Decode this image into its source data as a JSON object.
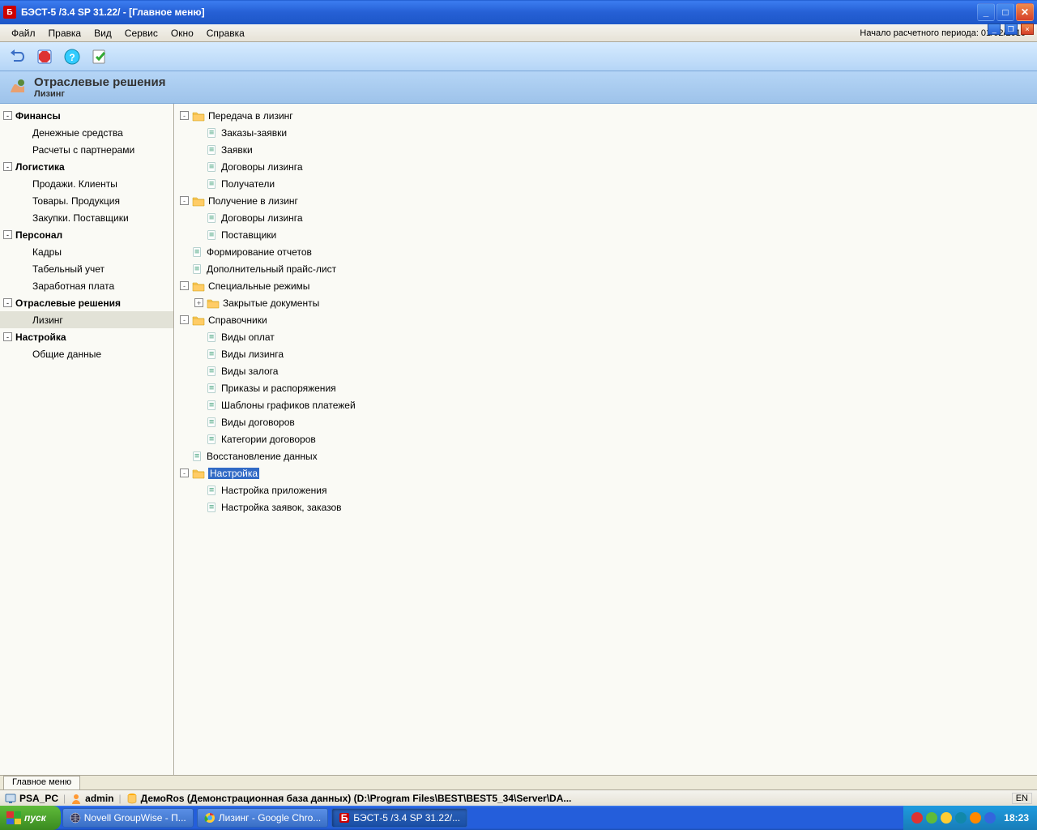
{
  "title": "БЭСТ-5 /3.4 SP 31.22/ - [Главное меню]",
  "menu": {
    "file": "Файл",
    "edit": "Правка",
    "view": "Вид",
    "service": "Сервис",
    "window": "Окно",
    "help": "Справка",
    "right": "Начало расчетного периода: 01/02/2010"
  },
  "header": {
    "title": "Отраслевые решения",
    "subtitle": "Лизинг"
  },
  "sidebar": [
    {
      "type": "group",
      "label": "Финансы",
      "exp": "-"
    },
    {
      "type": "child",
      "label": "Денежные средства"
    },
    {
      "type": "child",
      "label": "Расчеты с партнерами"
    },
    {
      "type": "group",
      "label": "Логистика",
      "exp": "-"
    },
    {
      "type": "child",
      "label": "Продажи. Клиенты"
    },
    {
      "type": "child",
      "label": "Товары. Продукция"
    },
    {
      "type": "child",
      "label": "Закупки. Поставщики"
    },
    {
      "type": "group",
      "label": "Персонал",
      "exp": "-"
    },
    {
      "type": "child",
      "label": "Кадры"
    },
    {
      "type": "child",
      "label": "Табельный учет"
    },
    {
      "type": "child",
      "label": "Заработная плата"
    },
    {
      "type": "group",
      "label": "Отраслевые решения",
      "exp": "-"
    },
    {
      "type": "child",
      "label": "Лизинг",
      "selected": true
    },
    {
      "type": "group",
      "label": "Настройка",
      "exp": "-"
    },
    {
      "type": "child",
      "label": "Общие данные"
    }
  ],
  "tree": [
    {
      "lvl": 0,
      "kind": "folder",
      "exp": "-",
      "label": "Передача в лизинг"
    },
    {
      "lvl": 1,
      "kind": "doc",
      "label": "Заказы-заявки"
    },
    {
      "lvl": 1,
      "kind": "doc",
      "label": "Заявки"
    },
    {
      "lvl": 1,
      "kind": "doc",
      "label": "Договоры лизинга"
    },
    {
      "lvl": 1,
      "kind": "doc",
      "label": "Получатели"
    },
    {
      "lvl": 0,
      "kind": "folder",
      "exp": "-",
      "label": "Получение в лизинг"
    },
    {
      "lvl": 1,
      "kind": "doc",
      "label": "Договоры лизинга"
    },
    {
      "lvl": 1,
      "kind": "doc",
      "label": "Поставщики"
    },
    {
      "lvl": 0,
      "kind": "doc",
      "noexp": true,
      "label": "Формирование отчетов"
    },
    {
      "lvl": 0,
      "kind": "doc",
      "noexp": true,
      "label": "Дополнительный прайс-лист"
    },
    {
      "lvl": 0,
      "kind": "folder",
      "exp": "-",
      "label": "Специальные режимы"
    },
    {
      "lvl": 1,
      "kind": "folder",
      "exp": "+",
      "label": "Закрытые документы"
    },
    {
      "lvl": 0,
      "kind": "folder",
      "exp": "-",
      "label": "Справочники"
    },
    {
      "lvl": 1,
      "kind": "doc",
      "label": "Виды оплат"
    },
    {
      "lvl": 1,
      "kind": "doc",
      "label": "Виды лизинга"
    },
    {
      "lvl": 1,
      "kind": "doc",
      "label": "Виды залога"
    },
    {
      "lvl": 1,
      "kind": "doc",
      "label": "Приказы и распоряжения"
    },
    {
      "lvl": 1,
      "kind": "doc",
      "label": "Шаблоны графиков платежей"
    },
    {
      "lvl": 1,
      "kind": "doc",
      "label": "Виды договоров"
    },
    {
      "lvl": 1,
      "kind": "doc",
      "label": "Категории договоров"
    },
    {
      "lvl": 0,
      "kind": "doc",
      "noexp": true,
      "label": "Восстановление данных"
    },
    {
      "lvl": 0,
      "kind": "folder",
      "exp": "-",
      "label": "Настройка",
      "selected": true
    },
    {
      "lvl": 1,
      "kind": "doc",
      "label": "Настройка приложения"
    },
    {
      "lvl": 1,
      "kind": "doc",
      "label": "Настройка заявок, заказов"
    }
  ],
  "tab": "Главное меню",
  "status": {
    "pc": "PSA_PC",
    "user": "admin",
    "db": "ДемоRos (Демонстрационная база данных) (D:\\Program Files\\BEST\\BEST5_34\\Server\\DA...",
    "lang": "EN"
  },
  "taskbar": {
    "start": "пуск",
    "tasks": [
      {
        "label": "Novell GroupWise - П...",
        "icon": "globe"
      },
      {
        "label": "Лизинг - Google Chro...",
        "icon": "chrome"
      },
      {
        "label": "БЭСТ-5 /3.4 SP 31.22/...",
        "icon": "app",
        "active": true
      }
    ],
    "clock": "18:23"
  }
}
